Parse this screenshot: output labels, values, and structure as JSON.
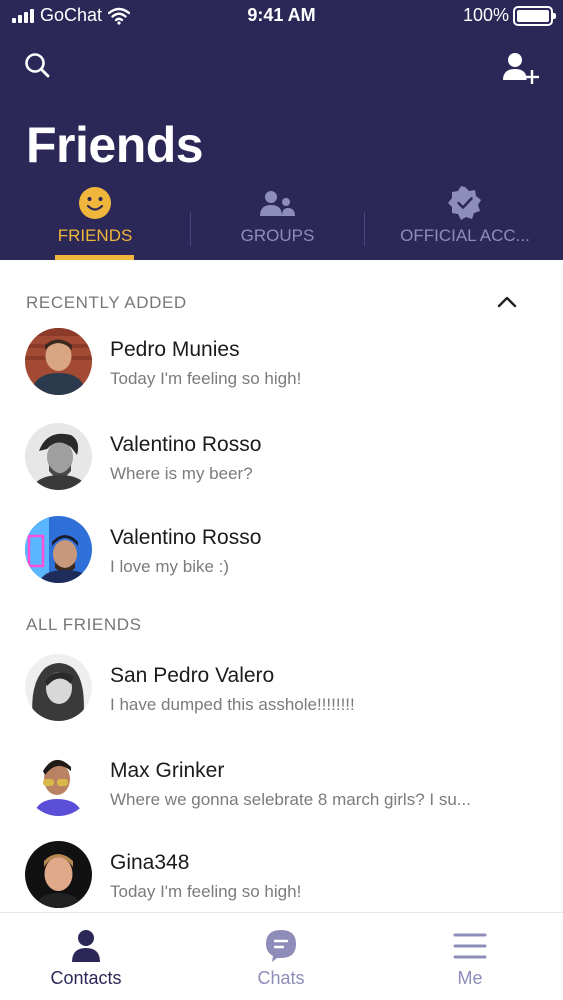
{
  "status_bar": {
    "carrier": "GoChat",
    "time": "9:41 AM",
    "battery": "100%"
  },
  "header": {
    "title": "Friends",
    "search_icon": "search-icon",
    "add_friend_icon": "add-person-icon"
  },
  "tabs": [
    {
      "label": "FRIENDS",
      "icon": "smiley-icon",
      "active": true
    },
    {
      "label": "GROUPS",
      "icon": "group-icon",
      "active": false
    },
    {
      "label": "OFFICIAL ACC...",
      "icon": "verified-badge-icon",
      "active": false
    }
  ],
  "sections": {
    "recent": "RECENTLY ADDED",
    "all": "ALL FRIENDS"
  },
  "recent_contacts": [
    {
      "name": "Pedro Munies",
      "status": "Today I'm feeling so high!"
    },
    {
      "name": "Valentino Rosso",
      "status": "Where is my beer?"
    },
    {
      "name": "Valentino Rosso",
      "status": "I love my bike :)"
    }
  ],
  "all_contacts": [
    {
      "name": "San Pedro Valero",
      "status": "I have dumped this asshole!!!!!!!!"
    },
    {
      "name": "Max Grinker",
      "status": "Where we gonna selebrate 8 march girls? I su..."
    },
    {
      "name": "Gina348",
      "status": "Today I'm feeling so high!"
    }
  ],
  "bottom_nav": [
    {
      "label": "Contacts",
      "icon": "person-icon",
      "active": true
    },
    {
      "label": "Chats",
      "icon": "chat-bubble-icon",
      "active": false
    },
    {
      "label": "Me",
      "icon": "menu-icon",
      "active": false
    }
  ],
  "colors": {
    "header_bg": "#2b2858",
    "accent": "#f0b63c",
    "inactive_tab": "#8e8cb8"
  }
}
